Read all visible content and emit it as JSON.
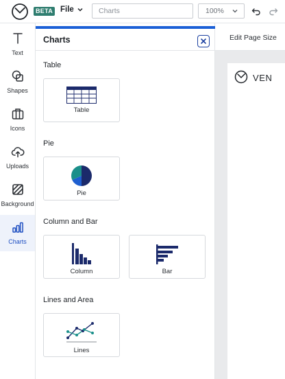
{
  "topbar": {
    "logo_icon": "circle-clock-logo-icon",
    "beta_badge": "BETA",
    "file_menu_label": "File",
    "search_placeholder": "Charts",
    "zoom_value": "100%",
    "undo_icon": "undo-icon",
    "redo_icon": "redo-icon"
  },
  "sidebar": {
    "items": [
      {
        "label": "Text",
        "icon": "text-icon",
        "active": false
      },
      {
        "label": "Shapes",
        "icon": "shapes-icon",
        "active": false
      },
      {
        "label": "Icons",
        "icon": "briefcase-icon",
        "active": false
      },
      {
        "label": "Uploads",
        "icon": "cloud-upload-icon",
        "active": false
      },
      {
        "label": "Background",
        "icon": "background-hatch-icon",
        "active": false
      },
      {
        "label": "Charts",
        "icon": "bar-chart-icon",
        "active": true
      }
    ]
  },
  "panel": {
    "title": "Charts",
    "close_icon": "close-icon",
    "sections": [
      {
        "title": "Table",
        "items": [
          {
            "label": "Table"
          }
        ]
      },
      {
        "title": "Pie",
        "items": [
          {
            "label": "Pie"
          }
        ]
      },
      {
        "title": "Column and Bar",
        "items": [
          {
            "label": "Column"
          },
          {
            "label": "Bar"
          }
        ]
      },
      {
        "title": "Lines and Area",
        "items": [
          {
            "label": "Lines"
          }
        ]
      }
    ]
  },
  "editor": {
    "edit_page_size": "Edit Page Size",
    "doc_brand": "VEN"
  },
  "colors": {
    "accent": "#1a5fd6",
    "navy": "#1b2a6b",
    "teal": "#1a8f8a",
    "beta": "#2e7d6f"
  }
}
